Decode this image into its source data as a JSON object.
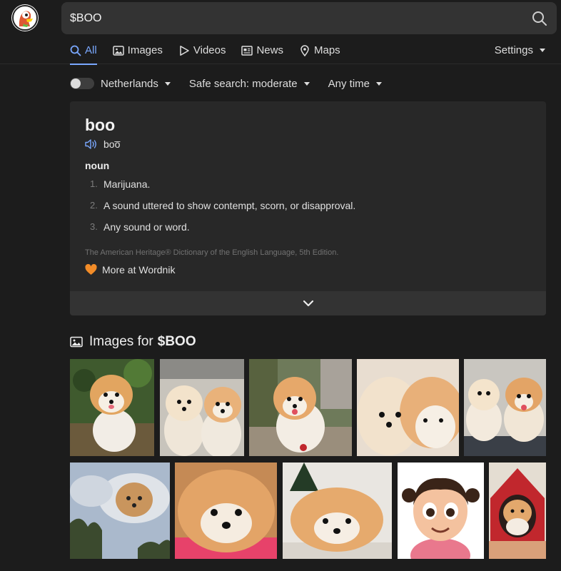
{
  "search": {
    "query": "$BOO"
  },
  "tabs": [
    {
      "label": "All",
      "icon": "search-icon",
      "active": true
    },
    {
      "label": "Images",
      "icon": "image-icon"
    },
    {
      "label": "Videos",
      "icon": "play-icon"
    },
    {
      "label": "News",
      "icon": "newspaper-icon"
    },
    {
      "label": "Maps",
      "icon": "map-pin-icon"
    }
  ],
  "settings": {
    "label": "Settings"
  },
  "filters": {
    "region": "Netherlands",
    "safe_search": "Safe search: moderate",
    "time": "Any time"
  },
  "definition": {
    "word": "boo",
    "pronunciation": "boo̅",
    "part_of_speech": "noun",
    "definitions": [
      {
        "num": "1.",
        "text": "Marijuana."
      },
      {
        "num": "2.",
        "text": "A sound uttered to show contempt, scorn, or disapproval."
      },
      {
        "num": "3.",
        "text": "Any sound or word."
      }
    ],
    "source": "The American Heritage® Dictionary of the English Language, 5th Edition.",
    "more_link": "More at Wordnik"
  },
  "images_section": {
    "prefix": "Images for",
    "query": "$BOO"
  },
  "images": [
    "pomeranian-puppy-on-grass",
    "two-pomeranians",
    "pomeranian-on-path",
    "pomeranians-close-up",
    "two-pomeranians-couch",
    "dog-face-in-clouds",
    "pomeranian-lying-on-blanket",
    "pomeranian-lying-down",
    "cartoon-girl-with-pigtails",
    "pomeranian-in-red-house"
  ],
  "colors": {
    "accent": "#7aa8ff",
    "background": "#1c1c1c",
    "card": "#282828",
    "heart": "#f28c28"
  }
}
